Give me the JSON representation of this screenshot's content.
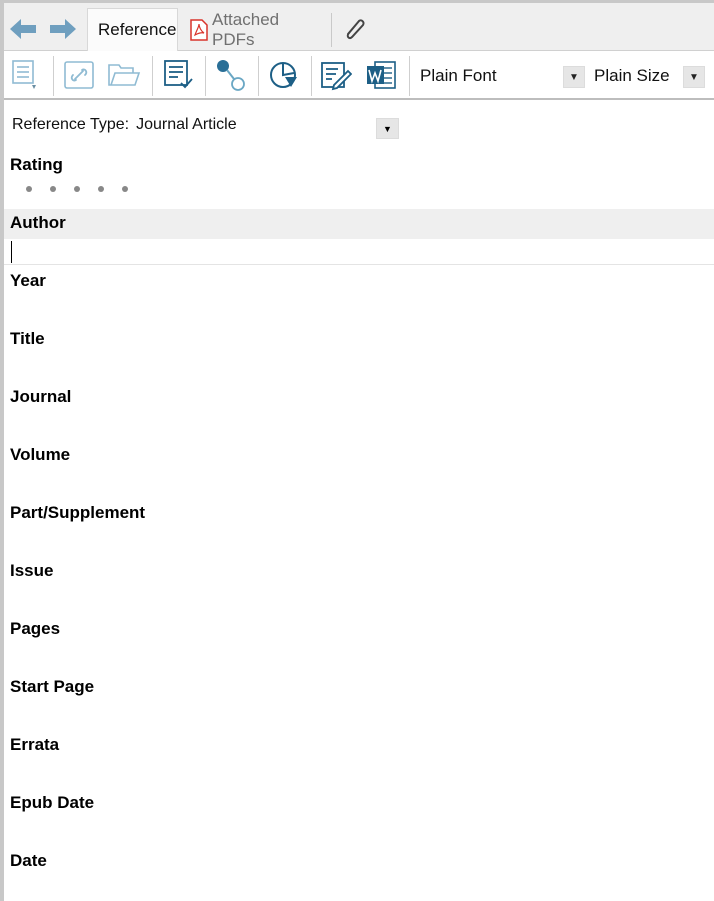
{
  "tabs": {
    "reference": "Reference",
    "attached_pdfs": "Attached PDFs"
  },
  "toolbar": {
    "font": "Plain Font",
    "size": "Plain Size",
    "icons": [
      "insert-reference-icon",
      "link-icon",
      "folder-icon",
      "format-reference-icon",
      "group-share-icon",
      "chart-icon",
      "edit-icon",
      "word-icon"
    ]
  },
  "reference": {
    "type_label": "Reference Type:",
    "type_value": "Journal Article",
    "rating_label": "Rating",
    "rating_value": "0 of 5",
    "fields": [
      {
        "label": "Author",
        "value": ""
      },
      {
        "label": "Year",
        "value": ""
      },
      {
        "label": "Title",
        "value": ""
      },
      {
        "label": "Journal",
        "value": ""
      },
      {
        "label": "Volume",
        "value": ""
      },
      {
        "label": "Part/Supplement",
        "value": ""
      },
      {
        "label": "Issue",
        "value": ""
      },
      {
        "label": "Pages",
        "value": ""
      },
      {
        "label": "Start Page",
        "value": ""
      },
      {
        "label": "Errata",
        "value": ""
      },
      {
        "label": "Epub Date",
        "value": ""
      },
      {
        "label": "Date",
        "value": ""
      }
    ]
  },
  "colors": {
    "accent": "#2a6f97",
    "toolbar_icon_light": "#6aa7c4",
    "pdf_red": "#d9342b"
  }
}
